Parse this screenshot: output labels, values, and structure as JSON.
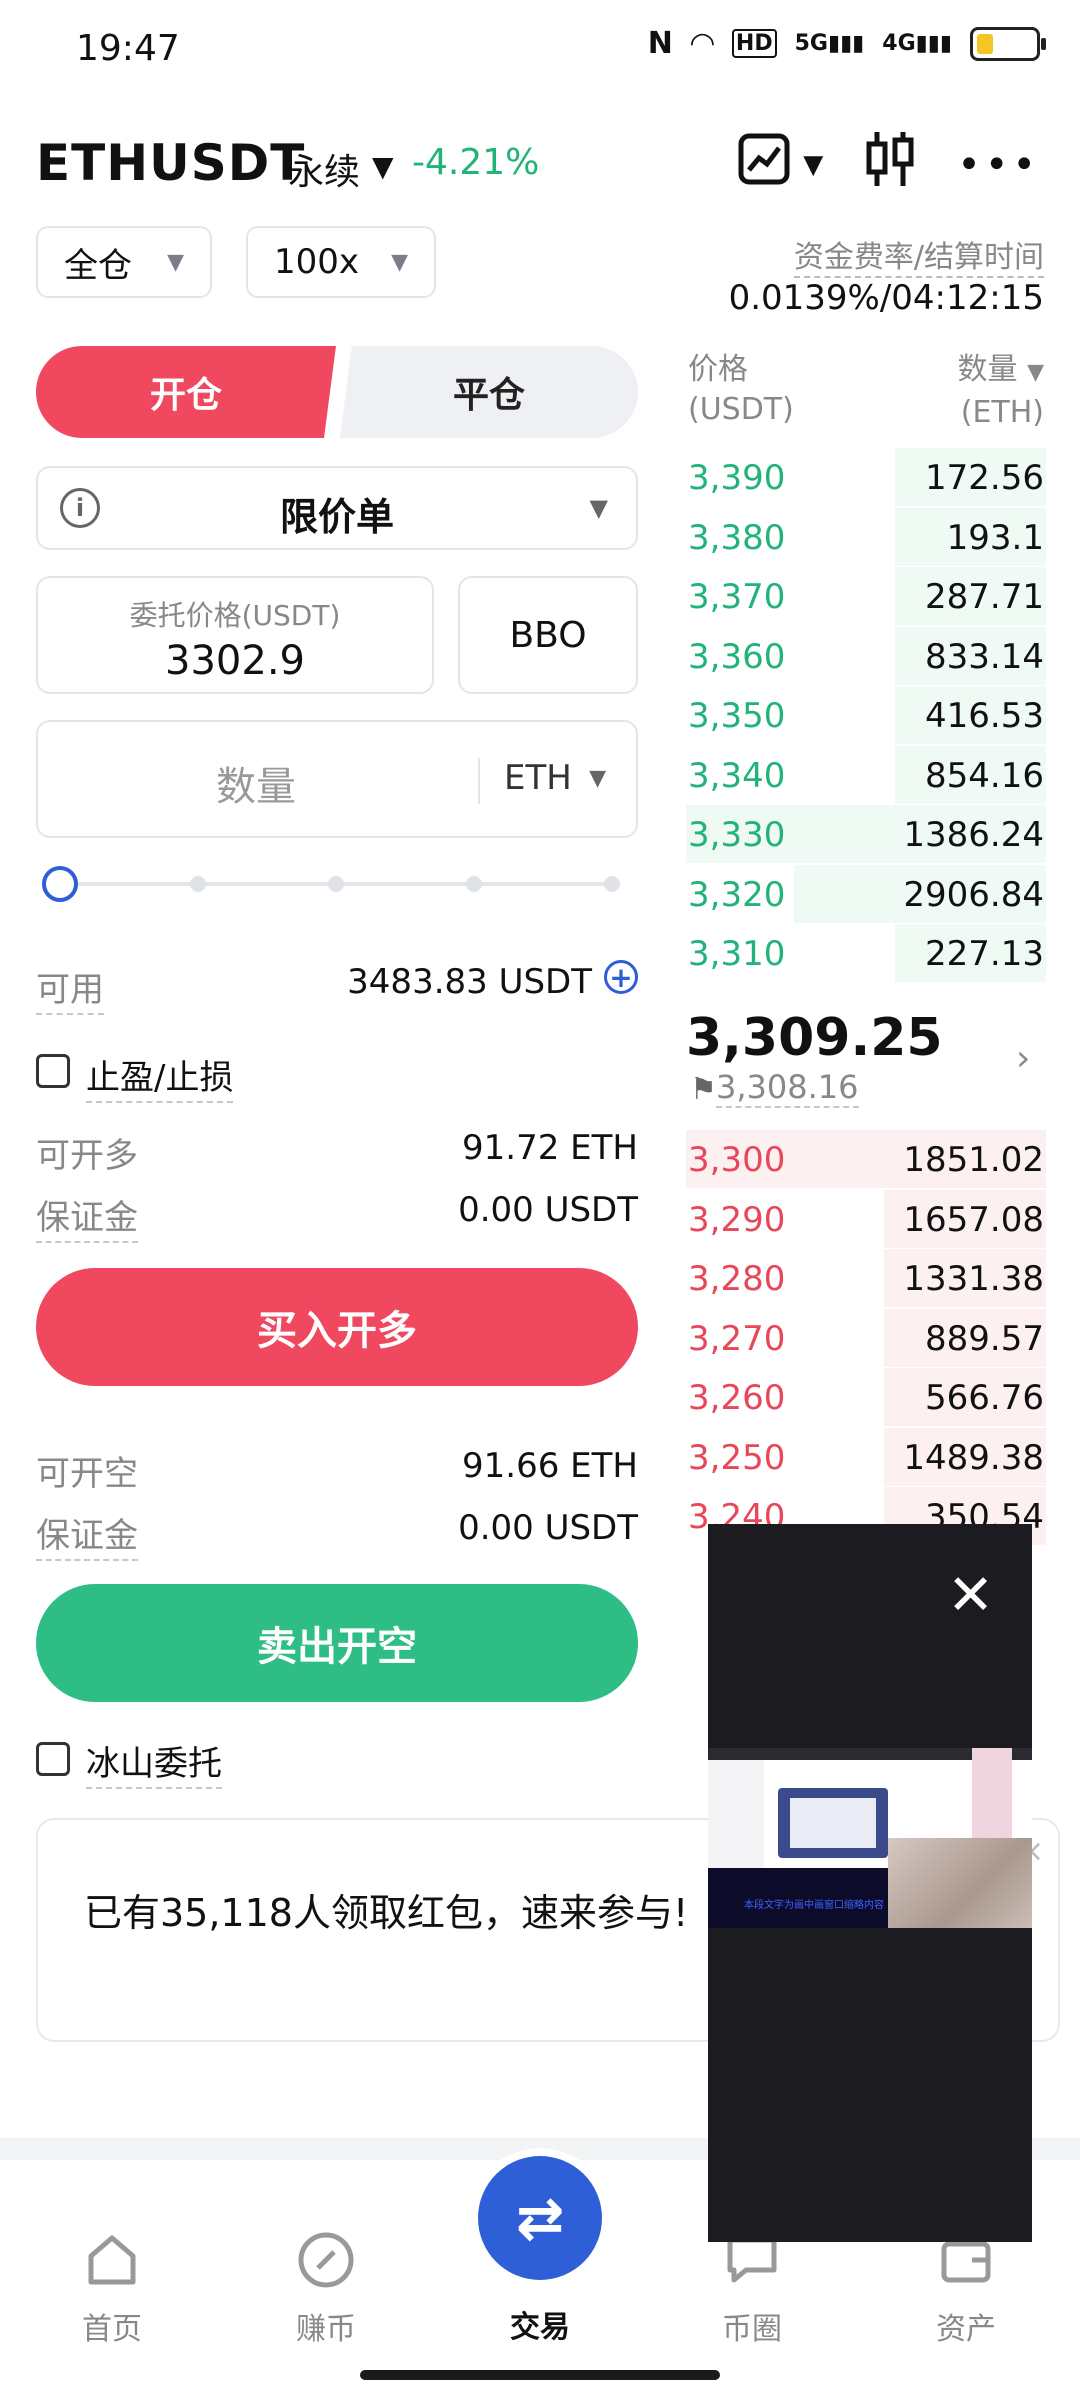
{
  "status_bar": {
    "time": "19:47",
    "icons": [
      "nfc-icon",
      "wifi-icon",
      "hd-icon",
      "5g-signal-icon",
      "4g-signal-icon",
      "battery-icon"
    ],
    "hd_label": "HD",
    "net_5g": "5G",
    "net_4g": "4G"
  },
  "header": {
    "pair": "ETHUSDT",
    "contract_type": "永续",
    "change": "-4.21%"
  },
  "selectors": {
    "margin_mode": "全仓",
    "leverage": "100x"
  },
  "funding": {
    "label": "资金费率/结算时间",
    "value": "0.0139%/04:12:15"
  },
  "tabs": {
    "open": "开仓",
    "close": "平仓"
  },
  "order_form": {
    "order_type": "限价单",
    "price_label": "委托价格(USDT)",
    "price_value": "3302.9",
    "bbo": "BBO",
    "qty_placeholder": "数量",
    "qty_unit": "ETH",
    "slider_percent": 0
  },
  "available": {
    "label": "可用",
    "value": "3483.83 USDT"
  },
  "tp_sl_label": "止盈/止损",
  "long": {
    "max_label": "可开多",
    "max_value": "91.72 ETH",
    "margin_label": "保证金",
    "margin_value": "0.00 USDT",
    "button": "买入开多"
  },
  "short": {
    "max_label": "可开空",
    "max_value": "91.66 ETH",
    "margin_label": "保证金",
    "margin_value": "0.00 USDT",
    "button": "卖出开空"
  },
  "iceberg_label": "冰山委托",
  "orderbook": {
    "price_header": "价格",
    "price_unit": "(USDT)",
    "qty_header": "数量",
    "qty_unit": "(ETH)",
    "asks": [
      {
        "price": "3,390",
        "qty": "172.56",
        "depth": 0.42
      },
      {
        "price": "3,380",
        "qty": "193.1",
        "depth": 0.42
      },
      {
        "price": "3,370",
        "qty": "287.71",
        "depth": 0.42
      },
      {
        "price": "3,360",
        "qty": "833.14",
        "depth": 0.42
      },
      {
        "price": "3,350",
        "qty": "416.53",
        "depth": 0.42
      },
      {
        "price": "3,340",
        "qty": "854.16",
        "depth": 0.42
      },
      {
        "price": "3,330",
        "qty": "1386.24",
        "depth": 1.0
      },
      {
        "price": "3,320",
        "qty": "2906.84",
        "depth": 0.7
      },
      {
        "price": "3,310",
        "qty": "227.13",
        "depth": 0.42
      }
    ],
    "last_price": "3,309.25",
    "mark_price": "3,308.16",
    "bids": [
      {
        "price": "3,300",
        "qty": "1851.02",
        "depth": 1.0
      },
      {
        "price": "3,290",
        "qty": "1657.08",
        "depth": 0.45
      },
      {
        "price": "3,280",
        "qty": "1331.38",
        "depth": 0.45
      },
      {
        "price": "3,270",
        "qty": "889.57",
        "depth": 0.45
      },
      {
        "price": "3,260",
        "qty": "566.76",
        "depth": 0.45
      },
      {
        "price": "3,250",
        "qty": "1489.38",
        "depth": 0.45
      },
      {
        "price": "3,240",
        "qty": "350.54",
        "depth": 0.45
      }
    ]
  },
  "banner": {
    "text": "已有35,118人领取红包，速来参与!"
  },
  "pip": {
    "caption": "本段文字为画中画窗口缩略内容"
  },
  "bottom_nav": {
    "items": [
      {
        "label": "首页",
        "icon": "home-icon"
      },
      {
        "label": "赚币",
        "icon": "earn-icon"
      },
      {
        "label": "交易",
        "icon": "trade-swap-icon"
      },
      {
        "label": "币圈",
        "icon": "community-icon"
      },
      {
        "label": "资产",
        "icon": "wallet-icon"
      }
    ]
  }
}
